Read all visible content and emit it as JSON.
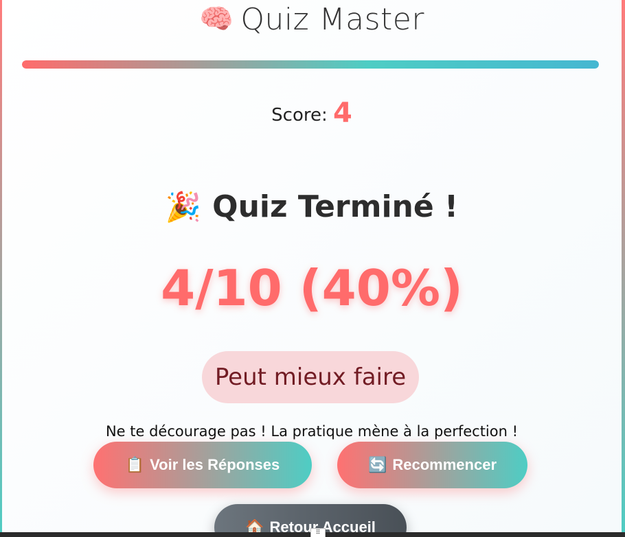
{
  "header": {
    "brain_icon": "🧠",
    "title": "Quiz Master"
  },
  "progress": {
    "fraction": 1.0,
    "colors": [
      "#ff6b6b",
      "#4ecdc4",
      "#45b7d1"
    ]
  },
  "score": {
    "label": "Score:",
    "value": "4"
  },
  "result": {
    "party_icon": "🎉",
    "heading": "Quiz Terminé !",
    "big_score": "4/10 (40%)",
    "verdict": "Peut mieux faire",
    "message": "Ne te décourage pas ! La pratique mène à la perfection !"
  },
  "buttons": {
    "answers": {
      "icon": "📋",
      "label": "Voir les Réponses"
    },
    "restart": {
      "icon": "🔄",
      "label": "Recommencer"
    },
    "home": {
      "icon": "🏠",
      "label": "Retour Accueil"
    }
  },
  "colors": {
    "accent": "#ff6b6b",
    "teal": "#4ecdc4",
    "verdict_bg": "#f8d7da",
    "verdict_text": "#721c24"
  },
  "grip_icon": "⠿"
}
